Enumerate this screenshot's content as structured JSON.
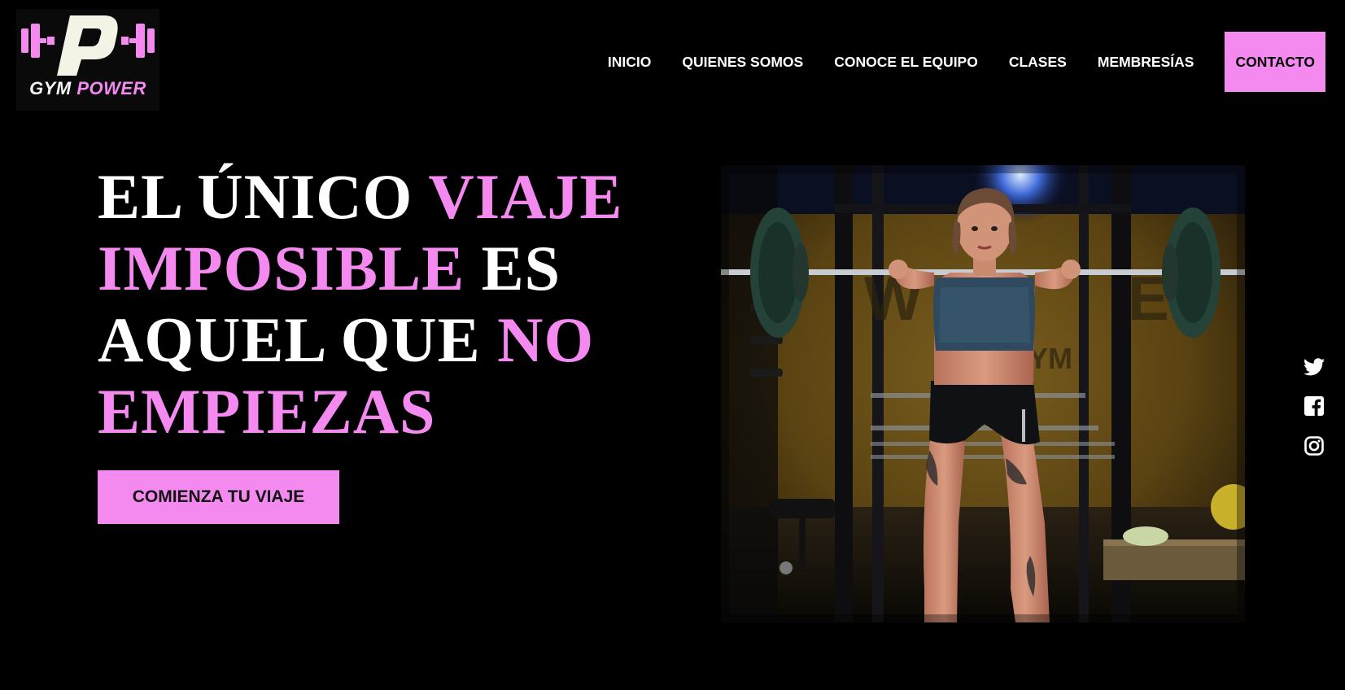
{
  "brand": {
    "logo_letter": "P",
    "name_part1": "GYM",
    "name_part2": "POWER",
    "accent_color": "#f489f0"
  },
  "nav": {
    "items": [
      {
        "label": "INICIO"
      },
      {
        "label": "QUIENES SOMOS"
      },
      {
        "label": "CONOCE EL EQUIPO"
      },
      {
        "label": "CLASES"
      },
      {
        "label": "MEMBRESÍAS"
      }
    ],
    "contact_label": "CONTACTO"
  },
  "hero": {
    "line1_a": "EL ÚNICO ",
    "line1_b": "VIAJE",
    "line2_a": "IMPOSIBLE",
    "line2_b": " ES",
    "line3_a": "AQUEL QUE ",
    "line3_b": "NO",
    "line4": "EMPIEZAS",
    "cta_label": "COMIENZA TU VIAJE"
  },
  "hero_image": {
    "subject": "woman lifting barbell in gym"
  },
  "social": {
    "icons": [
      "twitter-icon",
      "facebook-icon",
      "instagram-icon"
    ]
  }
}
